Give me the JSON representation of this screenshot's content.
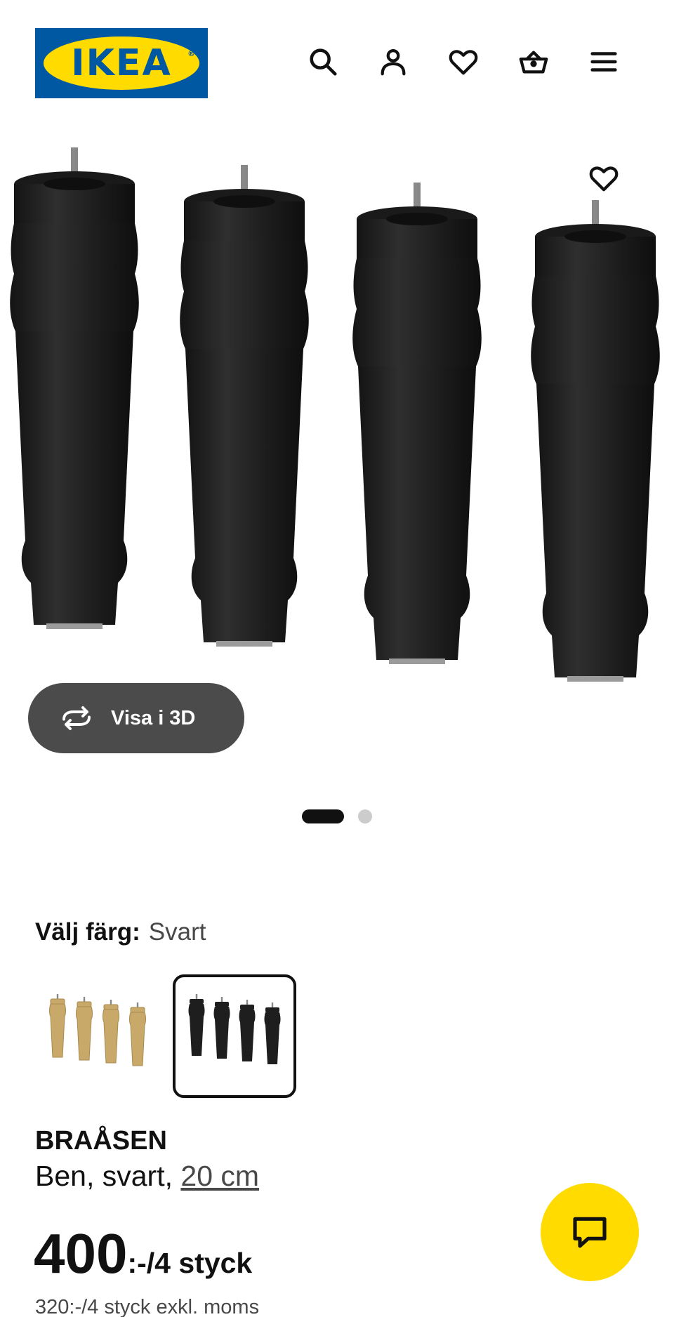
{
  "header": {
    "logo_text": "IKEA",
    "logo_reg": "®",
    "icons": [
      "search-icon",
      "account-icon",
      "heart-icon",
      "basket-icon",
      "menu-icon"
    ]
  },
  "gallery": {
    "favorite_icon": "heart-icon",
    "view_3d_label": "Visa i 3D",
    "slide_count": 2,
    "active_slide": 1
  },
  "color": {
    "label": "Välj färg:",
    "value": "Svart",
    "options": [
      "natural-wood",
      "black"
    ],
    "selected": "black"
  },
  "product": {
    "name": "BRAÅSEN",
    "desc_prefix": "Ben, svart,",
    "size": "20 cm"
  },
  "price": {
    "amount": "400",
    "unit": ":-/4 styck",
    "excl_vat": "320:-/4 styck exkl. moms"
  },
  "chat": {
    "icon": "chat-icon"
  },
  "colors": {
    "brand_blue": "#0058a3",
    "brand_yellow": "#ffdb00",
    "dark_button": "#4b4b4b",
    "leg_black": "#1e1e1e",
    "leg_wood": "#c9a96a"
  }
}
